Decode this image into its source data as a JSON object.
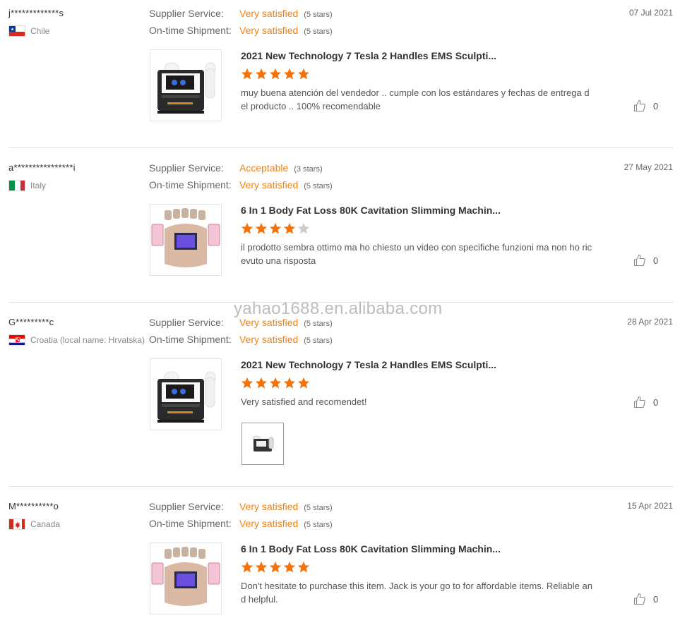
{
  "colors": {
    "accent": "#f5820f",
    "star_filled": "#f5720a",
    "star_empty": "#cccccc"
  },
  "labels": {
    "supplier_service": "Supplier Service:",
    "ontime_shipment": "On-time Shipment:"
  },
  "watermark": "yahao1688.en.alibaba.com",
  "reviews": [
    {
      "user": "j*************s",
      "country": "Chile",
      "flag": "chile",
      "date": "07 Jul 2021",
      "supplier_rating": "Very satisfied",
      "supplier_stars": "(5 stars)",
      "shipment_rating": "Very satisfied",
      "shipment_stars": "(5 stars)",
      "product_title": "2021 New Technology 7 Tesla 2 Handles EMS Sculpti...",
      "product_image": "ems-sculpting-machine",
      "rating": 5,
      "comment": "muy buena atención del vendedor .. cumple con los estándares y fechas de entrega del producto .. 100% recomendable",
      "likes": "0"
    },
    {
      "user": "a****************i",
      "country": "Italy",
      "flag": "italy",
      "date": "27 May 2021",
      "supplier_rating": "Acceptable",
      "supplier_stars": "(3 stars)",
      "shipment_rating": "Very satisfied",
      "shipment_stars": "(5 stars)",
      "product_title": "6 In 1 Body Fat Loss 80K Cavitation Slimming Machin...",
      "product_image": "cavitation-slimming-machine",
      "rating": 4,
      "comment": "il prodotto sembra  ottimo ma ho chiesto un video con specifiche funzioni ma non ho ricevuto una risposta",
      "likes": "0"
    },
    {
      "user": "G*********c",
      "country": "Croatia (local name: Hrvatska)",
      "flag": "croatia",
      "date": "28 Apr 2021",
      "supplier_rating": "Very satisfied",
      "supplier_stars": "(5 stars)",
      "shipment_rating": "Very satisfied",
      "shipment_stars": "(5 stars)",
      "product_title": "2021 New Technology 7 Tesla 2 Handles EMS Sculpti...",
      "product_image": "ems-sculpting-machine",
      "rating": 5,
      "comment": "Very satisfied  and recomendet!",
      "likes": "0",
      "attachment": "review-photo"
    },
    {
      "user": "M**********o",
      "country": "Canada",
      "flag": "canada",
      "date": "15 Apr 2021",
      "supplier_rating": "Very satisfied",
      "supplier_stars": "(5 stars)",
      "shipment_rating": "Very satisfied",
      "shipment_stars": "(5 stars)",
      "product_title": "6 In 1 Body Fat Loss 80K Cavitation Slimming Machin...",
      "product_image": "cavitation-slimming-machine",
      "rating": 5,
      "comment": "Don't hesitate to purchase this item. Jack is your go to for affordable items. Reliable and helpful.",
      "likes": "0"
    }
  ]
}
